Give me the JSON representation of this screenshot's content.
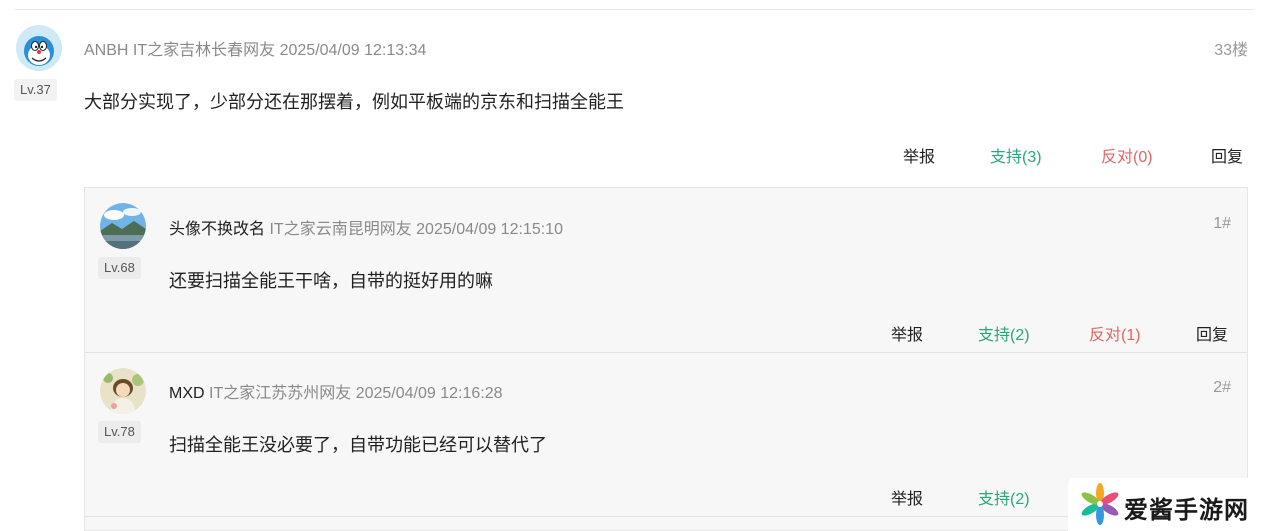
{
  "main_comment": {
    "username": "ANBH",
    "location": "IT之家吉林长春网友",
    "time": "2025/04/09 12:13:34",
    "floor": "33楼",
    "level": "Lv.37",
    "content": "大部分实现了，少部分还在那摆着，例如平板端的京东和扫描全能王",
    "actions": {
      "report": "举报",
      "support": "支持(3)",
      "oppose": "反对(0)",
      "reply": "回复"
    }
  },
  "replies": [
    {
      "username": "头像不换改名",
      "location": "IT之家云南昆明网友",
      "time": "2025/04/09 12:15:10",
      "floor": "1#",
      "level": "Lv.68",
      "content": "还要扫描全能王干啥，自带的挺好用的嘛",
      "actions": {
        "report": "举报",
        "support": "支持(2)",
        "oppose": "反对(1)",
        "reply": "回复"
      }
    },
    {
      "username": "MXD",
      "location": "IT之家江苏苏州网友",
      "time": "2025/04/09 12:16:28",
      "floor": "2#",
      "level": "Lv.78",
      "content": "扫描全能王没必要了，自带功能已经可以替代了",
      "actions": {
        "report": "举报",
        "support": "支持(2)"
      }
    }
  ],
  "watermark": {
    "text": "爱酱手游网"
  },
  "colors": {
    "support": "#27a87a",
    "oppose": "#e46464",
    "meta": "#8a8a8a"
  }
}
